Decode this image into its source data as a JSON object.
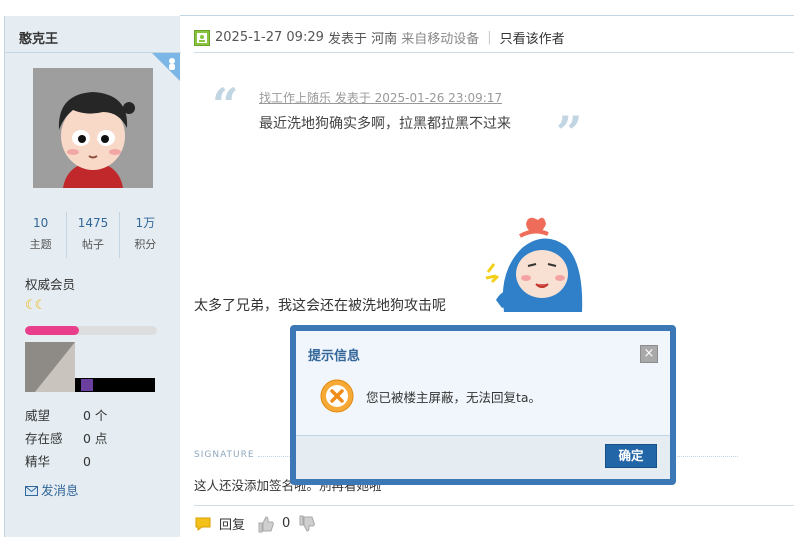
{
  "user": {
    "name": "憨克王",
    "stats": [
      {
        "value": "10",
        "label": "主题"
      },
      {
        "value": "1475",
        "label": "帖子"
      },
      {
        "value": "1万",
        "label": "积分"
      }
    ],
    "group": "权威会员",
    "level_icons": "☾☾",
    "level_progress": 0.41,
    "props": [
      {
        "key": "威望",
        "value": "0 个"
      },
      {
        "key": "存在感",
        "value": "0 点"
      },
      {
        "key": "精华",
        "value": "0"
      }
    ],
    "send_message": "发消息"
  },
  "post": {
    "date": "2025-1-27 09:29",
    "posted_at": "发表于",
    "location": "河南",
    "from_mobile": "来自移动设备",
    "separator": "|",
    "author_only": "只看该作者",
    "quote": {
      "meta": "找工作上随乐 发表于 2025-01-26 23:09:17",
      "body": "最近洗地狗确实多啊，拉黑都拉黑不过来"
    },
    "reply_text": "太多了兄弟，我这会还在被洗地狗攻击呢",
    "signature_label": "SIGNATURE",
    "signature_text": "这人还没添加签名啦。別再看她啦",
    "actions": {
      "reply": "回复",
      "likes": "0"
    }
  },
  "dialog": {
    "title": "提示信息",
    "close": "×",
    "message": "您已被楼主屏蔽，无法回复ta。",
    "ok": "确定"
  },
  "colors": {
    "accent": "#336699",
    "sidebar_bg": "#e5edf2",
    "dialog_border": "#3b78b5",
    "ok_button": "#2366a8",
    "error_icon": "#f39c12",
    "level_bar": "#e83e8c"
  }
}
